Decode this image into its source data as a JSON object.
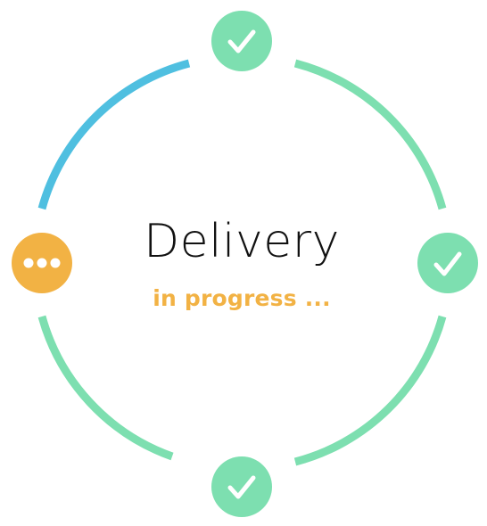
{
  "title": "Delivery",
  "status": "in progress ...",
  "colors": {
    "done": "#7ddfb0",
    "active_arc": "#4fbfe0",
    "pending": "#f2b244",
    "check": "#ffffff",
    "title": "#111111",
    "status": "#f2b244"
  },
  "steps": [
    {
      "position": "top",
      "state": "done",
      "icon": "check-icon"
    },
    {
      "position": "right",
      "state": "done",
      "icon": "check-icon"
    },
    {
      "position": "bottom",
      "state": "done",
      "icon": "check-icon"
    },
    {
      "position": "left",
      "state": "pending",
      "icon": "ellipsis-icon"
    }
  ]
}
